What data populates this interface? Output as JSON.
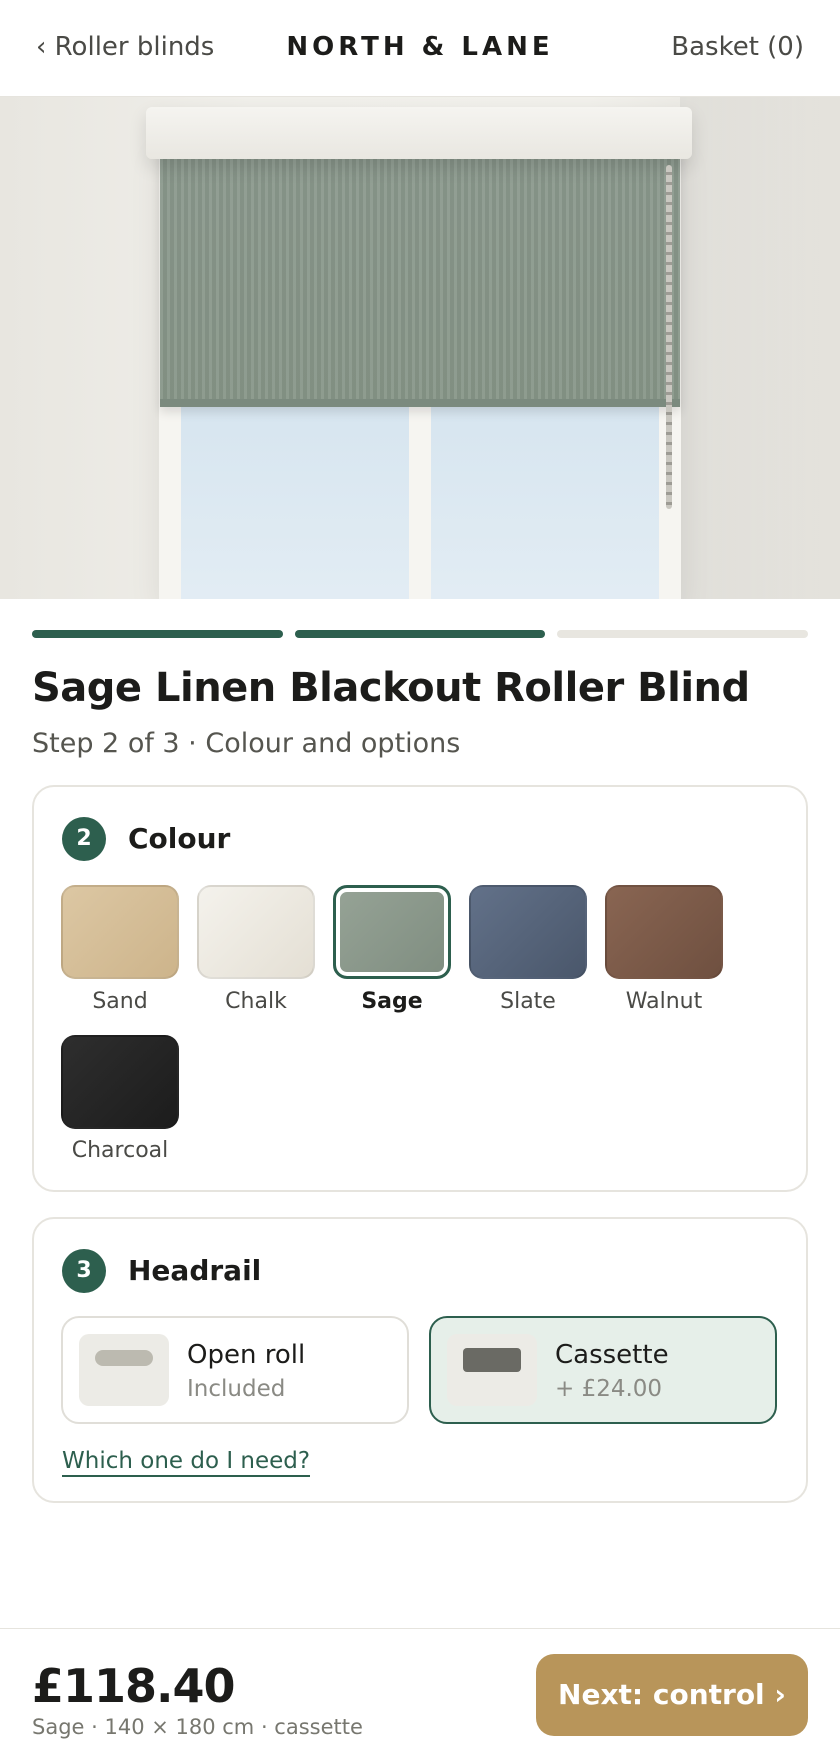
{
  "header": {
    "back_label": "‹ Roller blinds",
    "brand": "NORTH & LANE",
    "basket_label": "Basket (0)"
  },
  "progress": {
    "current_step": 2,
    "total_steps": 3
  },
  "product": {
    "title": "Sage Linen Blackout Roller Blind",
    "subtitle": "Step 2 of 3 · Colour and options"
  },
  "colour_section": {
    "step_number": "2",
    "title": "Colour",
    "selected": "Sage",
    "swatches": [
      {
        "label": "Sand",
        "color": "#d4bb94"
      },
      {
        "label": "Chalk",
        "color": "#ece8df"
      },
      {
        "label": "Sage",
        "color": "#8a988c"
      },
      {
        "label": "Slate",
        "color": "#566479"
      },
      {
        "label": "Walnut",
        "color": "#7c5a47"
      },
      {
        "label": "Charcoal",
        "color": "#252525"
      }
    ]
  },
  "headrail_section": {
    "step_number": "3",
    "title": "Headrail",
    "selected": "Cassette",
    "options": [
      {
        "name": "Open roll",
        "price": "Included",
        "icon": "open-roll-icon"
      },
      {
        "name": "Cassette",
        "price": "+ £24.00",
        "icon": "cassette-icon"
      }
    ],
    "help_link": "Which one do I need?"
  },
  "footer": {
    "price": "£118.40",
    "summary": "Sage · 140 × 180 cm · cassette",
    "next_label": "Next: control ›"
  },
  "colors": {
    "accent": "#2d5f4e",
    "cta": "#b8955a",
    "selected_option_bg": "#e6efe9"
  }
}
